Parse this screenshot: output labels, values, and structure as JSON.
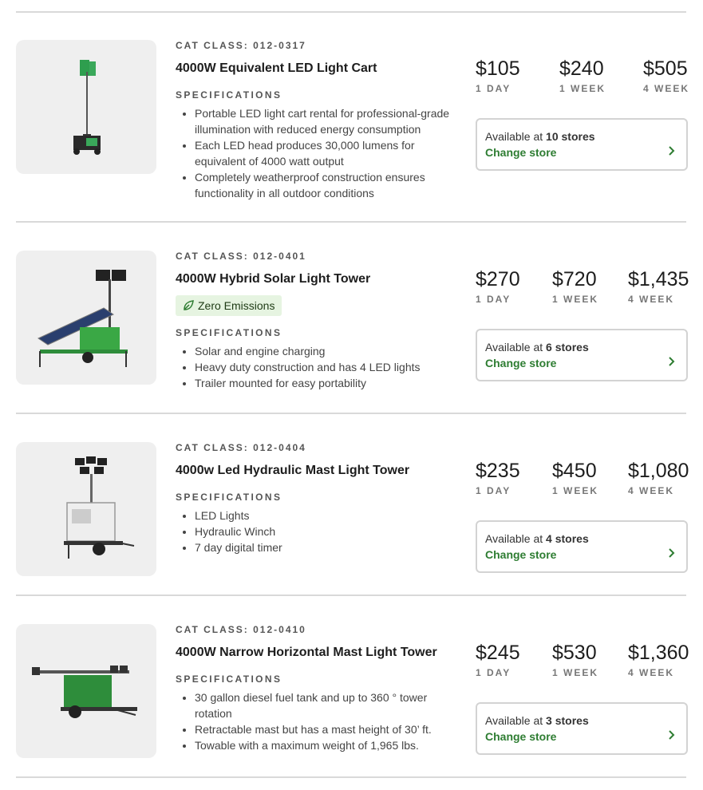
{
  "theme": {
    "accent_green": "#2e7d32",
    "badge_bg": "#e6f4e1",
    "thumb_bg": "#efefef",
    "divider": "#d9d9d9"
  },
  "labels": {
    "cat_class_prefix": "CAT CLASS:",
    "specifications": "SPECIFICATIONS",
    "change_store": "Change store",
    "available_at": "Available at",
    "per_day": "1 DAY",
    "per_week": "1 WEEK",
    "per_4week": "4 WEEK"
  },
  "products": [
    {
      "cat_class": "012-0317",
      "title": "4000W Equivalent LED Light Cart",
      "image_icon": "led-light-cart-icon",
      "specs": [
        "Portable LED light cart rental for professional-grade illumination with reduced energy consumption",
        "Each LED head produces 30,000 lumens for equivalent of 4000 watt output",
        "Completely weatherproof construction ensures functionality in all outdoor conditions"
      ],
      "prices": {
        "day": "$105",
        "week": "$240",
        "four_week": "$505"
      },
      "availability": "10 stores"
    },
    {
      "cat_class": "012-0401",
      "title": "4000W Hybrid Solar Light Tower",
      "image_icon": "solar-light-tower-icon",
      "badge": {
        "label": "Zero Emissions",
        "icon": "leaf-icon"
      },
      "specs": [
        "Solar and engine charging",
        "Heavy duty construction and has 4 LED lights",
        "Trailer mounted for easy portability"
      ],
      "prices": {
        "day": "$270",
        "week": "$720",
        "four_week": "$1,435"
      },
      "availability": "6 stores"
    },
    {
      "cat_class": "012-0404",
      "title": "4000w Led Hydraulic Mast Light Tower",
      "image_icon": "hydraulic-mast-light-tower-icon",
      "specs": [
        "LED Lights",
        "Hydraulic Winch",
        "7 day digital timer"
      ],
      "prices": {
        "day": "$235",
        "week": "$450",
        "four_week": "$1,080"
      },
      "availability": "4 stores"
    },
    {
      "cat_class": "012-0410",
      "title": "4000W Narrow Horizontal Mast Light Tower",
      "image_icon": "horizontal-mast-light-tower-icon",
      "specs": [
        "30 gallon diesel fuel tank and up to 360 ° tower rotation",
        "Retractable mast but has a mast height of 30’ ft.",
        "Towable with a maximum weight of 1,965 lbs."
      ],
      "prices": {
        "day": "$245",
        "week": "$530",
        "four_week": "$1,360"
      },
      "availability": "3 stores"
    }
  ]
}
